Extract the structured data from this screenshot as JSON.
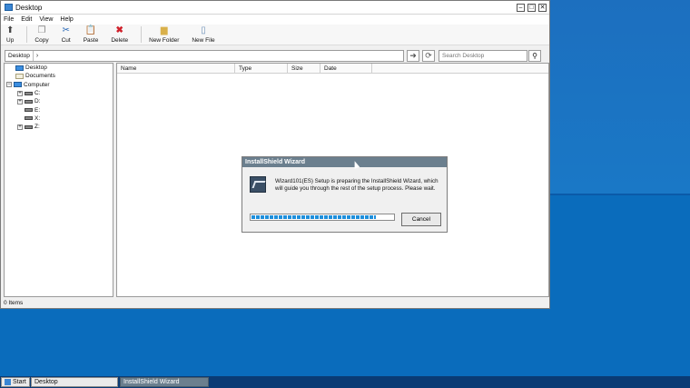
{
  "window": {
    "title": "Desktop"
  },
  "menu": [
    "File",
    "Edit",
    "View",
    "Help"
  ],
  "toolbar": [
    {
      "label": "Up",
      "icon": "up-arrow-icon"
    },
    {
      "label": "Copy",
      "icon": "copy-icon"
    },
    {
      "label": "Cut",
      "icon": "scissors-icon"
    },
    {
      "label": "Paste",
      "icon": "paste-icon"
    },
    {
      "label": "Delete",
      "icon": "delete-icon"
    },
    {
      "label": "New Folder",
      "icon": "new-folder-icon"
    },
    {
      "label": "New File",
      "icon": "new-file-icon"
    }
  ],
  "address": {
    "segment": "Desktop",
    "search_placeholder": "Search Desktop"
  },
  "tree": [
    {
      "label": "Desktop",
      "icon": "monitor-icon"
    },
    {
      "label": "Documents",
      "icon": "documents-icon"
    },
    {
      "label": "Computer",
      "icon": "computer-icon"
    },
    {
      "label": "C:",
      "icon": "drive-icon"
    },
    {
      "label": "D:",
      "icon": "drive-icon"
    },
    {
      "label": "E:",
      "icon": "drive-icon"
    },
    {
      "label": "X:",
      "icon": "drive-icon"
    },
    {
      "label": "Z:",
      "icon": "drive-icon"
    }
  ],
  "columns": [
    "Name",
    "Type",
    "Size",
    "Date"
  ],
  "status": "0 Items",
  "dialog": {
    "title": "InstallShield Wizard",
    "message": "Wizard101(ES) Setup is preparing the InstallShield Wizard, which will guide you through the rest of the setup process. Please wait.",
    "cancel_label": "Cancel",
    "progress": 0.88
  },
  "taskbar": {
    "start_label": "Start",
    "tasks": [
      "Desktop",
      "InstallShield Wizard"
    ]
  }
}
